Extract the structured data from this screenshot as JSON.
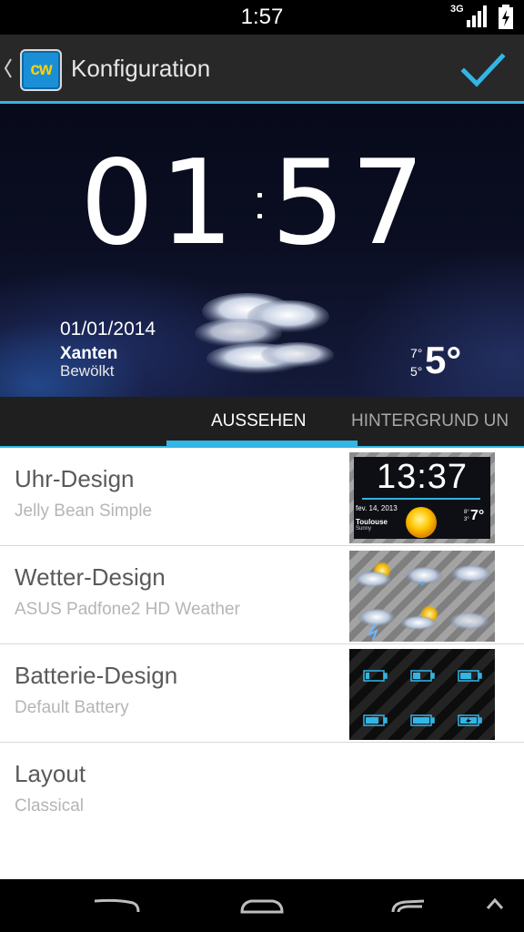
{
  "status_bar": {
    "time": "1:57",
    "network": "3G",
    "signal": "signal-icon",
    "battery": "battery-charging-icon"
  },
  "action_bar": {
    "up_icon": "chevron-left-icon",
    "logo_text": "cw",
    "title": "Konfiguration",
    "done_icon": "checkmark-icon"
  },
  "widget_preview": {
    "clock_hours": "01",
    "clock_minutes": "57",
    "date": "01/01/2014",
    "city": "Xanten",
    "condition": "Bewölkt",
    "temp_high": "7°",
    "temp_low": "5°",
    "temp_current": "5°",
    "weather_icon": "cloud-icon"
  },
  "tabs": [
    {
      "label": "AUSSEHEN",
      "active": true
    },
    {
      "label": "HINTERGRUND UN",
      "active": false
    }
  ],
  "settings": [
    {
      "title": "Uhr-Design",
      "subtitle": "Jelly Bean Simple",
      "thumb": {
        "time": "13:37",
        "date": "fev. 14, 2013",
        "city": "Toulouse",
        "condition": "Sunny",
        "hi": "8°",
        "lo": "3°",
        "temp": "7°"
      }
    },
    {
      "title": "Wetter-Design",
      "subtitle": "ASUS Padfone2 HD Weather"
    },
    {
      "title": "Batterie-Design",
      "subtitle": "Default Battery"
    },
    {
      "title": "Layout",
      "subtitle": "Classical"
    }
  ],
  "colors": {
    "accent": "#33b5e5",
    "action_bar": "#282828",
    "list_bg": "#ffffff",
    "title_text": "#5a5a5a",
    "subtitle_text": "#b5b5b5"
  }
}
